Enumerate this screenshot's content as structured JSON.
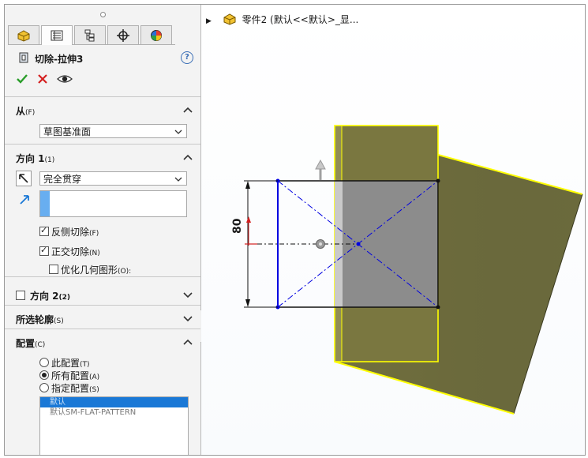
{
  "tabs": [
    {
      "icon": "part-icon"
    },
    {
      "icon": "property-manager-icon"
    },
    {
      "icon": "configuration-manager-icon"
    },
    {
      "icon": "dimxpert-icon"
    },
    {
      "icon": "display-manager-icon"
    }
  ],
  "feature": {
    "title": "切除-拉伸3"
  },
  "from": {
    "header": "从",
    "header_key": "(F)",
    "value": "草图基准面"
  },
  "direction1": {
    "header": "方向 1",
    "header_key": "(1)",
    "end_condition": "完全贯穿",
    "depth_value": "",
    "flip_side": {
      "label": "反侧切除",
      "key": "(F)",
      "checked": true
    },
    "normal_cut": {
      "label": "正交切除",
      "key": "(N)",
      "checked": true
    },
    "optimize": {
      "label": "优化几何图形",
      "key": "(O):",
      "checked": false
    }
  },
  "direction2": {
    "label": "方向 2",
    "key": "(2)",
    "checked": false
  },
  "selected_contours": {
    "header": "所选轮廓",
    "key": "(S)"
  },
  "configuration": {
    "header": "配置",
    "header_key": "(C)",
    "options": [
      {
        "label": "此配置",
        "key": "(T)",
        "selected": false
      },
      {
        "label": "所有配置",
        "key": "(A)",
        "selected": true
      },
      {
        "label": "指定配置",
        "key": "(S)",
        "selected": false
      }
    ],
    "list": [
      "默认",
      "默认SM-FLAT-PATTERN"
    ]
  },
  "feature_tree": {
    "label": "零件2  (默认<<默认>_显..."
  },
  "dimension": {
    "value": "80"
  },
  "colors": {
    "accent": "#1a78d6",
    "sketch": "#0000e0",
    "plate_face": "#7a7740",
    "plate_edge": "#ffff00",
    "check": "#2a9d2a",
    "cross": "#d42020"
  }
}
